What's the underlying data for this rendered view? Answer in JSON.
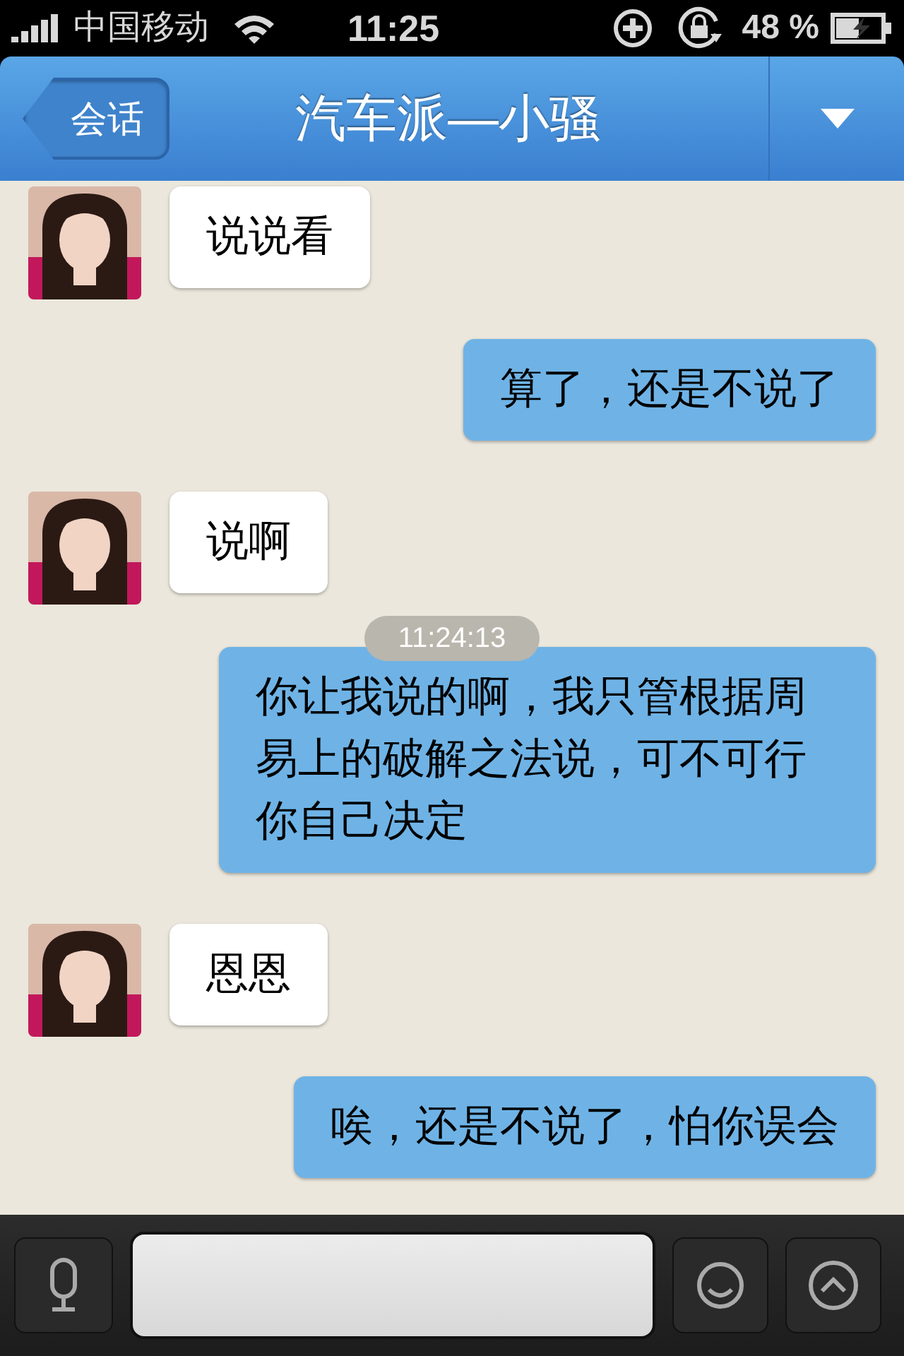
{
  "status_bar": {
    "carrier": "中国移动",
    "time": "11:25",
    "battery": "48 %"
  },
  "nav_bar": {
    "back": "会话",
    "title": "汽车派—小骚"
  },
  "messages": [
    {
      "kind": "incoming",
      "text": "说说看"
    },
    {
      "kind": "outgoing",
      "text": "算了，还是不说了"
    },
    {
      "kind": "incoming",
      "text": "说啊"
    },
    {
      "kind": "time",
      "text": "11:24:13"
    },
    {
      "kind": "outgoing",
      "text": "你让我说的啊，我只管根据周易上的破解之法说，可不可行你自己决定"
    },
    {
      "kind": "incoming",
      "text": "恩恩"
    },
    {
      "kind": "outgoing",
      "text": "唉，还是不说了，怕你误会"
    }
  ]
}
